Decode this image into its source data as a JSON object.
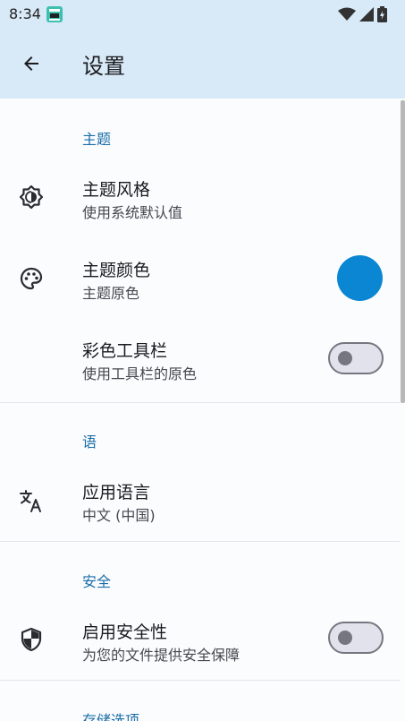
{
  "status_bar": {
    "time": "8:34"
  },
  "app_bar": {
    "title": "设置"
  },
  "sections": [
    {
      "header": "主题",
      "items": [
        {
          "title": "主题风格",
          "subtitle": "使用系统默认值",
          "icon": "brightness-auto-icon"
        },
        {
          "title": "主题颜色",
          "subtitle": "主题原色",
          "icon": "palette-icon",
          "accent_color": "#0b86d2"
        },
        {
          "title": "彩色工具栏",
          "subtitle": "使用工具栏的原色",
          "switch_on": false
        }
      ]
    },
    {
      "header": "语",
      "items": [
        {
          "title": "应用语言",
          "subtitle": "中文 (中国)",
          "icon": "translate-icon"
        }
      ]
    },
    {
      "header": "安全",
      "items": [
        {
          "title": "启用安全性",
          "subtitle": "为您的文件提供安全保障",
          "icon": "shield-icon",
          "switch_on": false
        }
      ]
    },
    {
      "header": "存储选项",
      "items": []
    }
  ],
  "colors": {
    "app_bar_bg": "#d8eaf7",
    "section_header": "#1a6ea8",
    "accent_dot": "#0b86d2"
  }
}
